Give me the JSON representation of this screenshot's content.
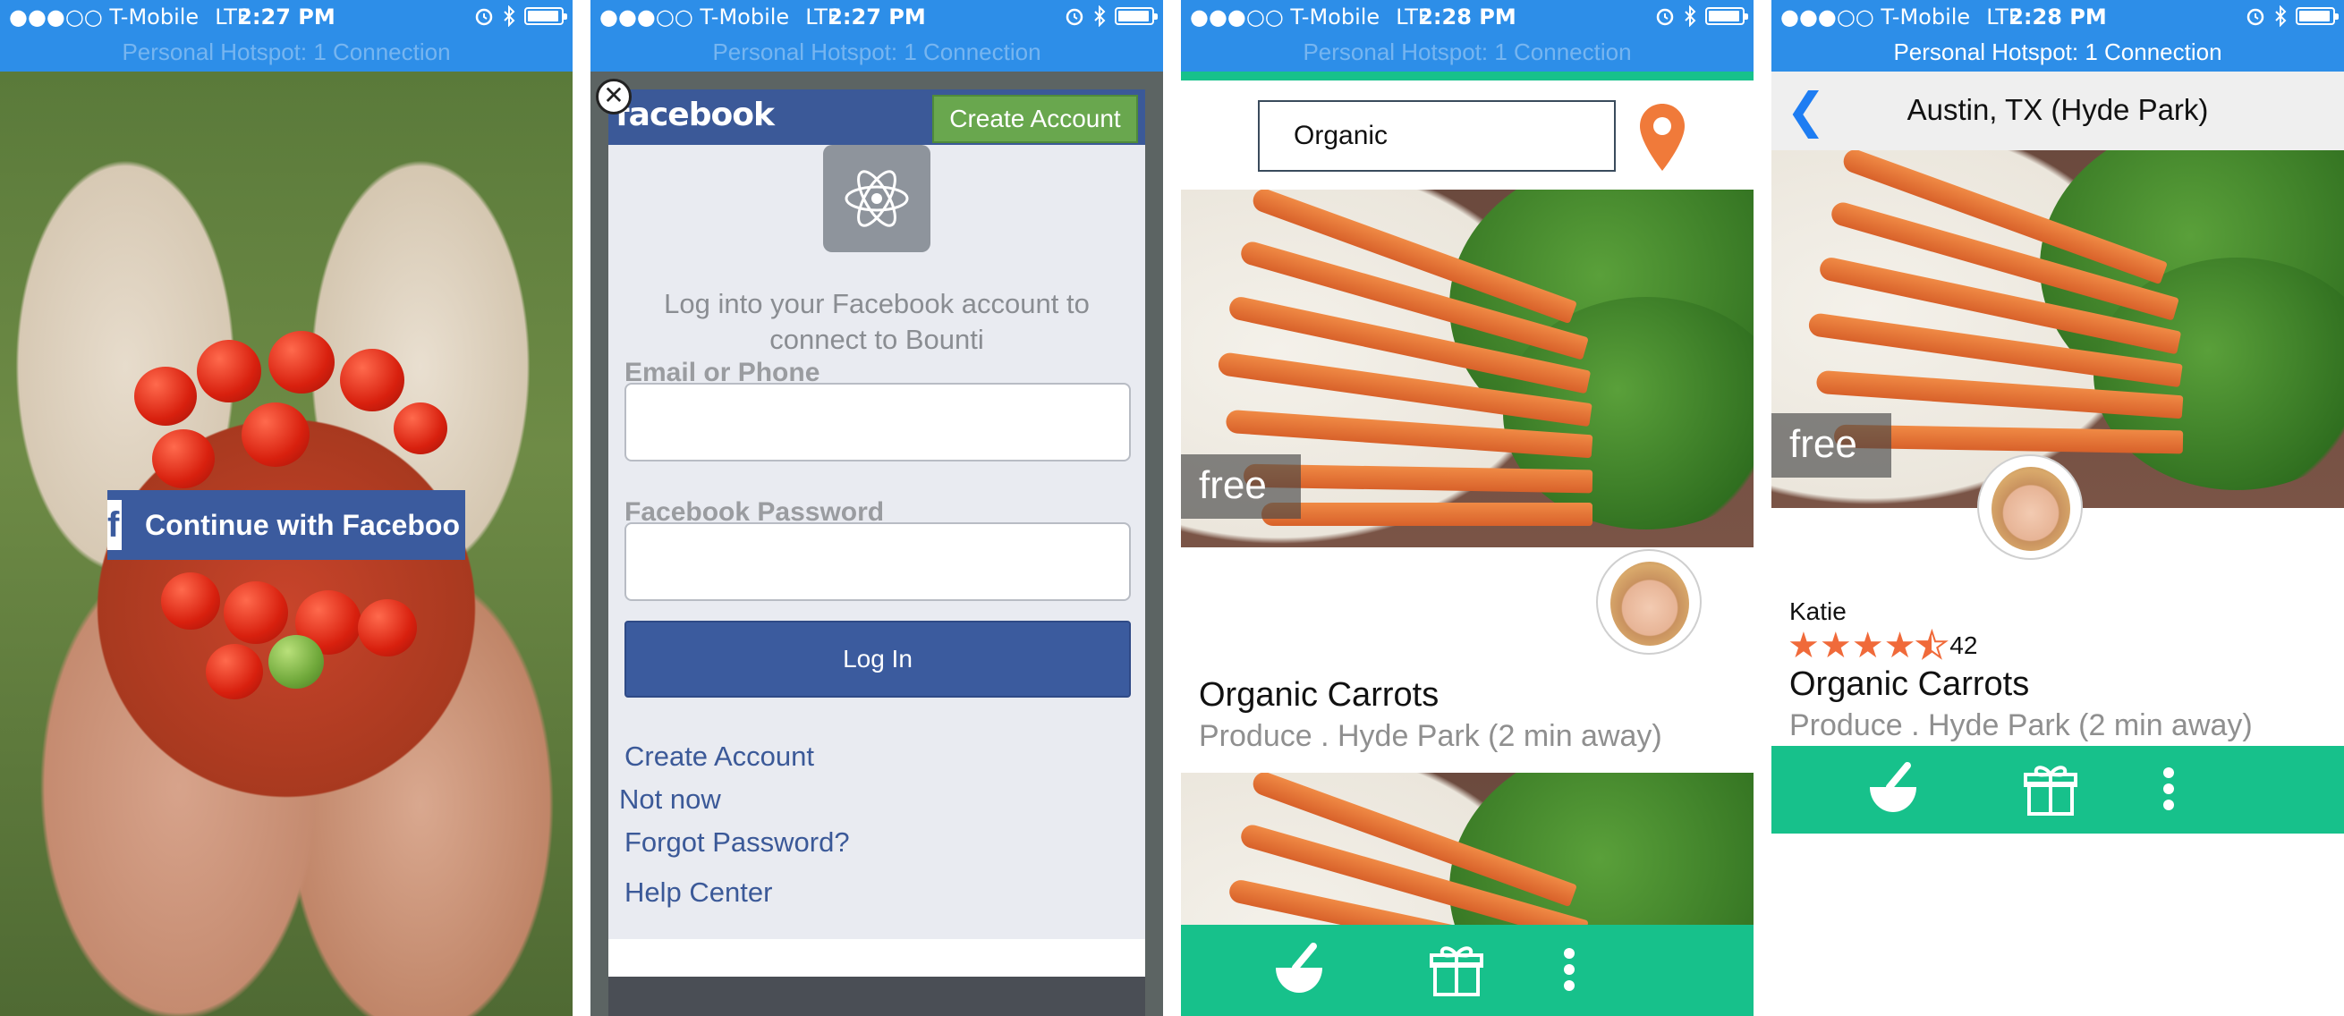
{
  "status": [
    {
      "carrier": "●●●○○ T-Mobile",
      "network": "LTE",
      "time": "2:27 PM",
      "hotspot": "Personal Hotspot: 1 Connection"
    },
    {
      "carrier": "●●●○○ T-Mobile",
      "network": "LTE",
      "time": "2:27 PM",
      "hotspot": "Personal Hotspot: 1 Connection"
    },
    {
      "carrier": "●●●○○ T-Mobile",
      "network": "LTE",
      "time": "2:28 PM",
      "hotspot": "Personal Hotspot: 1 Connection"
    },
    {
      "carrier": "●●●○○ T-Mobile",
      "network": "LTE",
      "time": "2:28 PM",
      "hotspot": "Personal Hotspot: 1 Connection"
    }
  ],
  "screen1": {
    "continue_label": "Continue with Faceboo",
    "fb_glyph": "f"
  },
  "screen2": {
    "close_glyph": "✕",
    "brand": "facebook",
    "create_account_top": "Create Account",
    "prompt": "Log into your Facebook account to connect to Bounti",
    "email_label": "Email or Phone",
    "password_label": "Facebook Password",
    "email_value": "",
    "password_value": "",
    "login_label": "Log In",
    "links": {
      "create_account": "Create Account",
      "not_now": "Not now",
      "forgot_password": "Forgot Password?",
      "help_center": "Help Center"
    }
  },
  "screen3": {
    "search_value": "Organic",
    "listing": {
      "price": "free",
      "title": "Organic Carrots",
      "subtitle": "Produce . Hyde Park (2 min away)"
    },
    "second_price": ""
  },
  "screen4": {
    "back_glyph": "❮",
    "title": "Austin, TX (Hyde Park)",
    "price": "free",
    "seller": "Katie",
    "rating": 4.5,
    "rating_count": "42",
    "item_title": "Organic Carrots",
    "item_subtitle": "Produce . Hyde Park (2 min away)"
  },
  "icons": {
    "pin_color": "#f07a3a",
    "accent_teal": "#17c18b",
    "status_blue": "#2d8ee8",
    "facebook_blue": "#3b5998"
  }
}
